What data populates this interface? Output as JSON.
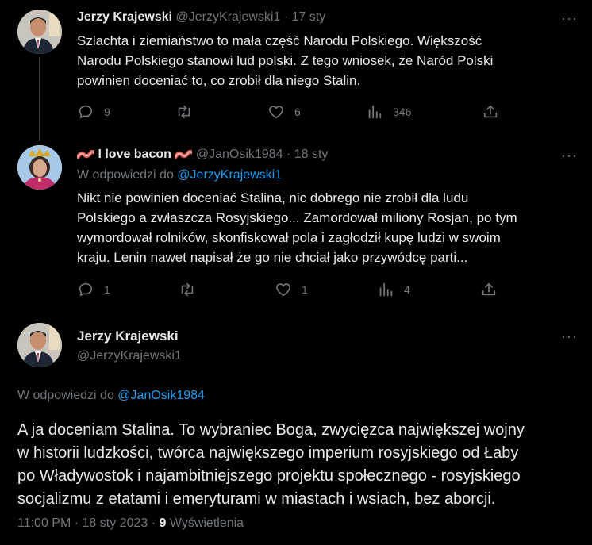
{
  "tweets": [
    {
      "name": "Jerzy Krajewski",
      "handle": "@JerzyKrajewski1",
      "date": "17 sty",
      "text_lines": [
        "Szlachta i ziemiaństwo to mała część Narodu Polskiego. Większość",
        "Narodu Polskiego stanowi lud polski. Z tego wniosek, że Naród Polski",
        "powinien doceniać to, co zrobił dla niego Stalin."
      ],
      "replies": "9",
      "retweets": "",
      "likes": "6",
      "views": "346"
    },
    {
      "name": "I love bacon",
      "handle": "@JanOsik1984",
      "date": "18 sty",
      "reply_prefix": "W odpowiedzi do",
      "reply_handle": "@JerzyKrajewski1",
      "text_lines": [
        "Nikt nie powinien doceniać Stalina, nic dobrego nie zrobił dla ludu",
        "Polskiego a zwłaszcza Rosyjskiego... Zamordował miliony Rosjan, po tym",
        "wymordował rolników, skonfiskował pola i zagłodził kupę  ludzi w swoim",
        "kraju. Lenin nawet napisał że go nie chciał jako przywódcę parti..."
      ],
      "replies": "1",
      "retweets": "",
      "likes": "1",
      "views": "4"
    }
  ],
  "main": {
    "name": "Jerzy Krajewski",
    "handle": "@JerzyKrajewski1",
    "reply_prefix": "W odpowiedzi do",
    "reply_handle": "@JanOsik1984",
    "text_lines": [
      "A ja doceniam Stalina. To wybraniec Boga, zwycięzca największej wojny",
      "w historii ludzkości, twórca największego imperium rosyjskiego od Łaby",
      "po Władywostok i najambitniejszego projektu społecznego - rosyjskiego",
      "socjalizmu z etatami i emeryturami w miastach i wsiach, bez aborcji."
    ],
    "time": "11:00 PM",
    "date": "18 sty 2023",
    "views_count": "9",
    "views_label": "Wyświetlenia"
  },
  "more_glyph": "···",
  "separator": "·",
  "colors": {
    "bg": "#000000",
    "text": "#e7e9ea",
    "muted": "#71767b",
    "link": "#1d9bf0",
    "line": "#333639"
  }
}
